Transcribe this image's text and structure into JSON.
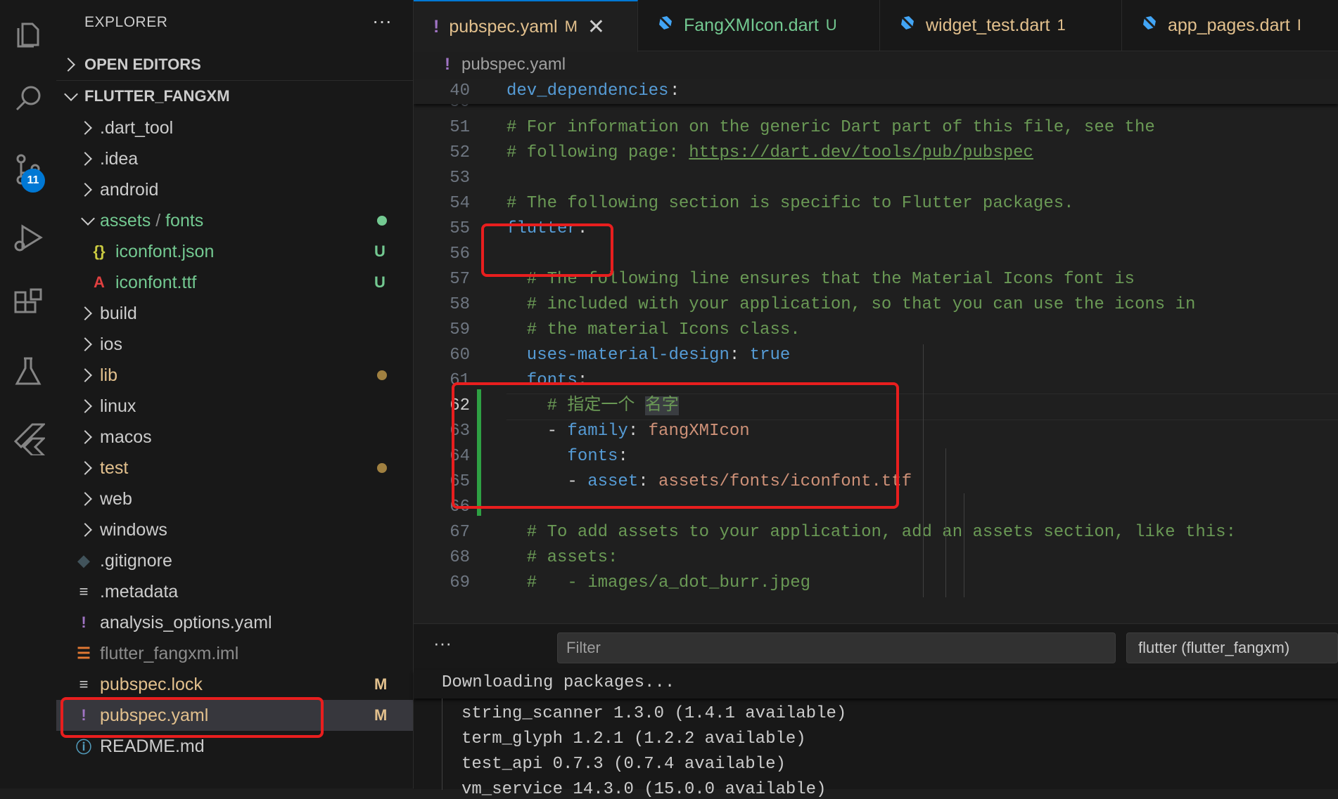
{
  "activity_bar": {
    "items": [
      "explorer-icon",
      "search-icon",
      "source-control-icon",
      "run-debug-icon",
      "extensions-icon",
      "testing-icon",
      "flutter-icon"
    ],
    "source_control_badge": "11"
  },
  "sidebar": {
    "title": "EXPLORER",
    "more": "···",
    "open_editors": "OPEN EDITORS",
    "project": "FLUTTER_FANGXM",
    "tree": [
      {
        "label": ".dart_tool",
        "kind": "folder",
        "color": "#cccccc"
      },
      {
        "label": ".idea",
        "kind": "folder",
        "color": "#cccccc"
      },
      {
        "label": "android",
        "kind": "folder",
        "color": "#cccccc"
      },
      {
        "label": "assets",
        "label2": "fonts",
        "kind": "folder-open",
        "color": "#73c991",
        "dot": "#73c991"
      },
      {
        "label": "iconfont.json",
        "kind": "file",
        "icon": "{}",
        "icon_color": "#cbcb41",
        "color": "#73c991",
        "status": "U"
      },
      {
        "label": "iconfont.ttf",
        "kind": "file",
        "icon": "A",
        "icon_color": "#e04040",
        "color": "#73c991",
        "status": "U"
      },
      {
        "label": "build",
        "kind": "folder",
        "color": "#cccccc"
      },
      {
        "label": "ios",
        "kind": "folder",
        "color": "#cccccc"
      },
      {
        "label": "lib",
        "kind": "folder",
        "color": "#e2c08d",
        "dot": "#a08040"
      },
      {
        "label": "linux",
        "kind": "folder",
        "color": "#cccccc"
      },
      {
        "label": "macos",
        "kind": "folder",
        "color": "#cccccc"
      },
      {
        "label": "test",
        "kind": "folder",
        "color": "#e2c08d",
        "dot": "#a08040"
      },
      {
        "label": "web",
        "kind": "folder",
        "color": "#cccccc"
      },
      {
        "label": "windows",
        "kind": "folder",
        "color": "#cccccc"
      },
      {
        "label": ".gitignore",
        "kind": "file",
        "icon": "◆",
        "icon_color": "#41535b",
        "color": "#cccccc"
      },
      {
        "label": ".metadata",
        "kind": "file",
        "icon": "≡",
        "icon_color": "#cccccc",
        "color": "#cccccc"
      },
      {
        "label": "analysis_options.yaml",
        "kind": "file",
        "icon": "!",
        "icon_color": "#a074c4",
        "color": "#cccccc"
      },
      {
        "label": "flutter_fangxm.iml",
        "kind": "file",
        "icon": "☰",
        "icon_color": "#e37933",
        "color": "#8c8c8c"
      },
      {
        "label": "pubspec.lock",
        "kind": "file",
        "icon": "≡",
        "icon_color": "#cccccc",
        "color": "#e2c08d",
        "status": "M"
      },
      {
        "label": "pubspec.yaml",
        "kind": "file",
        "icon": "!",
        "icon_color": "#a074c4",
        "color": "#e2c08d",
        "status": "M",
        "selected": true
      },
      {
        "label": "README.md",
        "kind": "file",
        "icon": "ⓘ",
        "icon_color": "#519aba",
        "color": "#cccccc"
      }
    ]
  },
  "tabs": [
    {
      "icon": "!",
      "icon_color": "#a074c4",
      "label": "pubspec.yaml",
      "label_color": "#e2c08d",
      "mod": "M",
      "close": "✕",
      "active": true
    },
    {
      "icon": "dart",
      "label": "FangXMIcon.dart",
      "label_color": "#73c991",
      "mod": "U"
    },
    {
      "icon": "dart",
      "label": "widget_test.dart",
      "label_color": "#e2c08d",
      "mod": "1"
    },
    {
      "icon": "dart",
      "label": "app_pages.dart",
      "label_color": "#e2c08d",
      "mod": "I"
    }
  ],
  "breadcrumb": {
    "icon": "!",
    "file": "pubspec.yaml"
  },
  "editor": {
    "sticky": {
      "num": "40",
      "key": "dev_dependencies",
      "colon": ":"
    },
    "lines": [
      {
        "num": "50",
        "parts": []
      },
      {
        "num": "51",
        "parts": [
          {
            "t": "# For information on the generic Dart part of this file, see the",
            "c": "cmt"
          }
        ]
      },
      {
        "num": "52",
        "parts": [
          {
            "t": "# following page: ",
            "c": "cmt"
          },
          {
            "t": "https://dart.dev/tools/pub/pubspec",
            "c": "lnk"
          }
        ]
      },
      {
        "num": "53",
        "parts": []
      },
      {
        "num": "54",
        "parts": [
          {
            "t": "# The following section is specific to Flutter packages.",
            "c": "cmt"
          }
        ]
      },
      {
        "num": "55",
        "parts": [
          {
            "t": "flutter",
            "c": "key"
          },
          {
            "t": ":",
            "c": "white"
          }
        ]
      },
      {
        "num": "56",
        "parts": []
      },
      {
        "num": "57",
        "parts": [
          {
            "t": "  # The following line ensures that the Material Icons font is",
            "c": "cmt"
          }
        ]
      },
      {
        "num": "58",
        "parts": [
          {
            "t": "  # included with your application, so that you can use the icons in",
            "c": "cmt"
          }
        ]
      },
      {
        "num": "59",
        "parts": [
          {
            "t": "  # the material Icons class.",
            "c": "cmt"
          }
        ]
      },
      {
        "num": "60",
        "parts": [
          {
            "t": "  uses-material-design",
            "c": "key"
          },
          {
            "t": ": ",
            "c": "white"
          },
          {
            "t": "true",
            "c": "kw"
          }
        ]
      },
      {
        "num": "61",
        "parts": [
          {
            "t": "  fonts",
            "c": "key"
          },
          {
            "t": ":",
            "c": "white"
          }
        ]
      },
      {
        "num": "62",
        "current": true,
        "parts": [
          {
            "t": "    # 指定一个 ",
            "c": "cmt"
          },
          {
            "t": "名字",
            "c": "cmt sel-word"
          }
        ]
      },
      {
        "num": "63",
        "parts": [
          {
            "t": "    - ",
            "c": "white"
          },
          {
            "t": "family",
            "c": "key"
          },
          {
            "t": ": ",
            "c": "white"
          },
          {
            "t": "fangXMIcon",
            "c": "str"
          }
        ]
      },
      {
        "num": "64",
        "parts": [
          {
            "t": "      fonts",
            "c": "key"
          },
          {
            "t": ":",
            "c": "white"
          }
        ]
      },
      {
        "num": "65",
        "parts": [
          {
            "t": "      - ",
            "c": "white"
          },
          {
            "t": "asset",
            "c": "key"
          },
          {
            "t": ": ",
            "c": "white"
          },
          {
            "t": "assets/fonts/iconfont.ttf",
            "c": "str"
          }
        ]
      },
      {
        "num": "66",
        "parts": []
      },
      {
        "num": "67",
        "parts": [
          {
            "t": "  # To add assets to your application, add an assets section, like this:",
            "c": "cmt"
          }
        ]
      },
      {
        "num": "68",
        "parts": [
          {
            "t": "  # assets:",
            "c": "cmt"
          }
        ]
      },
      {
        "num": "69",
        "parts": [
          {
            "t": "  #   - images/a_dot_burr.jpeg",
            "c": "cmt"
          }
        ]
      }
    ]
  },
  "panel": {
    "more": "···",
    "filter_placeholder": "Filter",
    "channel": "flutter (flutter_fangxm)",
    "sticky": "Downloading packages...",
    "lines": [
      "string_scanner 1.3.0 (1.4.1 available)",
      "term_glyph 1.2.1 (1.2.2 available)",
      "test_api 0.7.3 (0.7.4 available)",
      "vm_service 14.3.0 (15.0.0 available)"
    ]
  },
  "colors": {
    "highlight": "#e81e1e",
    "accent": "#0078d4",
    "added_gutter": "#2ea043"
  }
}
